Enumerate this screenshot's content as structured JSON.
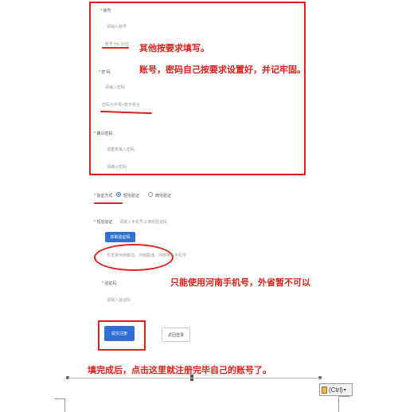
{
  "form": {
    "account_label": "* 账号",
    "account_placeholder": "请输入账号",
    "account_hint": "账号为6-20位",
    "password_label": "* 密 码",
    "password_placeholder": "请输入密码",
    "password_hint": "密码为字母+数字组合",
    "confirm_label": "* 确认密码",
    "confirm_placeholder": "请重复输入密码",
    "confirm_hint": "请确认密码",
    "verify_method_label": "* 验证方式",
    "sms_option": "短信验证",
    "wechat_option": "微信验证",
    "sms_verify_label": "* 短信验证",
    "sms_verify_placeholder": "请输入手机号以接收验证码",
    "get_code_button": "获取验证码",
    "phone_note": "仅支持河南移动、河南联通、河南电信手机号",
    "code_label": "* 验证码",
    "code_placeholder": "请输入验证码",
    "submit_button": "提交注册",
    "back_button": "返回登录"
  },
  "annotations": {
    "line1": "其他按要求填写。",
    "line2": "账号，密码自己按要求设置好，并记牢固。",
    "phone": "只能使用河南手机号，外省暂不可以",
    "submit": "填完成后，点击这里就注册完毕自己的账号了。"
  },
  "doc_ui": {
    "paste_label": "(Ctrl)",
    "paste_chevron": "▾"
  },
  "colors": {
    "annotation_red": "#e0201a",
    "primary_blue": "#2f6fd6"
  }
}
